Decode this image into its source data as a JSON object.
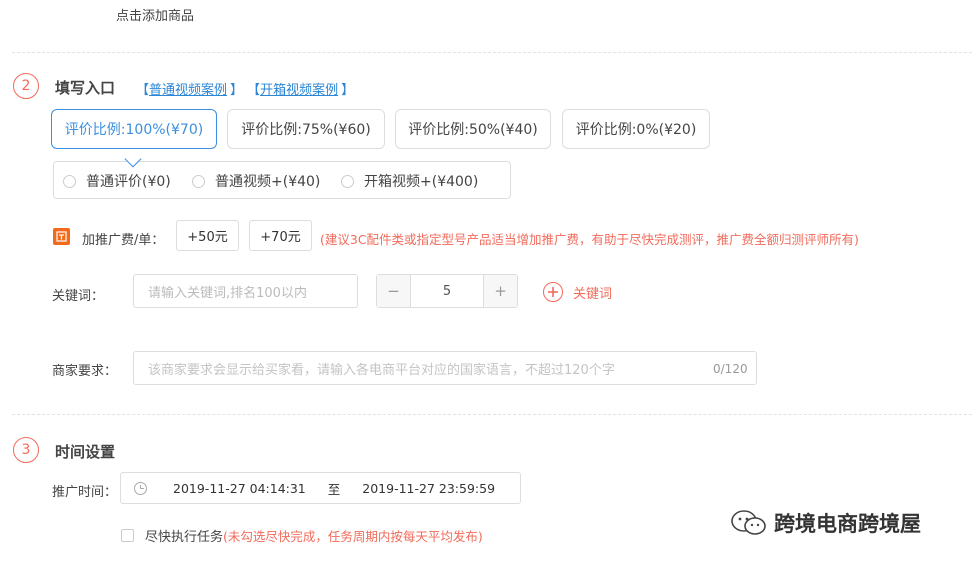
{
  "top": {
    "add_product": "点击添加商品"
  },
  "section2": {
    "number": "2",
    "title": "填写入口",
    "link_normal": "普通视频案例",
    "link_unbox": "开箱视频案例",
    "bracket_open": "【",
    "bracket_close": "】",
    "ratios": [
      {
        "label": "评价比例:100%(¥70)",
        "active": true
      },
      {
        "label": "评价比例:75%(¥60)",
        "active": false
      },
      {
        "label": "评价比例:50%(¥40)",
        "active": false
      },
      {
        "label": "评价比例:0%(¥20)",
        "active": false
      }
    ],
    "review_types": [
      {
        "label": "普通评价(¥0)"
      },
      {
        "label": "普通视频+(¥40)"
      },
      {
        "label": "开箱视频+(¥400)"
      }
    ],
    "promo_fee": {
      "icon": "price-tag-icon",
      "label": "加推广费/单：",
      "option1": "+50元",
      "option2": "+70元",
      "hint": "(建议3C配件类或指定型号产品适当增加推广费，有助于尽快完成测评，推广费全额归测评师所有)"
    },
    "keyword": {
      "label": "关键词：",
      "placeholder": "请输入关键词,排名100以内",
      "minus": "−",
      "quantity": "5",
      "plus": "+",
      "add_label": "关键词"
    },
    "merchant": {
      "label": "商家要求：",
      "placeholder": "该商家要求会显示给买家看，请输入各电商平台对应的国家语言，不超过120个字",
      "counter": "0/120"
    }
  },
  "section3": {
    "number": "3",
    "title": "时间设置",
    "time_label": "推广时间：",
    "start": "2019-11-27 04:14:31",
    "separator": "至",
    "end": "2019-11-27 23:59:59",
    "asap_label": "尽快执行任务",
    "asap_hint": "(未勾选尽快完成，任务周期内按每天平均发布)"
  },
  "watermark": {
    "text": "跨境电商跨境屋",
    "icon": "wechat-icon"
  },
  "colors": {
    "accent": "#3b8fe0",
    "warn": "#f26b5b"
  }
}
